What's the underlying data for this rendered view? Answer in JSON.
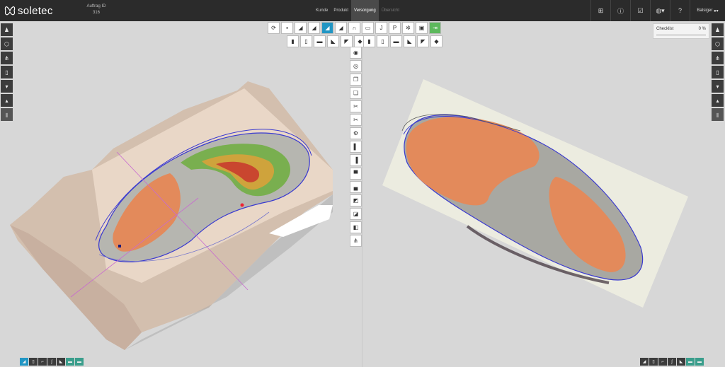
{
  "app": {
    "brand": "soletec"
  },
  "order": {
    "label": "Auftrag ID",
    "id": "316"
  },
  "nav": {
    "items": [
      {
        "label": "Kunde",
        "state": "normal"
      },
      {
        "label": "Produkt",
        "state": "normal"
      },
      {
        "label": "Versorgung",
        "state": "active"
      },
      {
        "label": "Übersicht",
        "state": "disabled"
      }
    ]
  },
  "header_tools": {
    "icons": [
      "apps-grid-icon",
      "info-icon",
      "checkbox-icon",
      "globe-icon",
      "help-icon"
    ],
    "user": "Batsiger"
  },
  "checklist": {
    "label": "Checklist",
    "percent": "0 %",
    "progress": 0
  },
  "toolbar_main": [
    {
      "name": "rotate-icon",
      "glyph": "⟳"
    },
    {
      "name": "layers-icon",
      "glyph": "▪"
    },
    {
      "name": "insole-green-icon",
      "glyph": "◢"
    },
    {
      "name": "insole-dark-icon",
      "glyph": "◢"
    },
    {
      "name": "insole-selected-icon",
      "glyph": "◢",
      "selected": true
    },
    {
      "name": "insole-outline-icon",
      "glyph": "◢"
    },
    {
      "name": "foot-print-icon",
      "glyph": "∩"
    },
    {
      "name": "ruler-icon",
      "glyph": "▭"
    },
    {
      "name": "jpg-download-icon",
      "glyph": "J"
    },
    {
      "name": "pdf-download-icon",
      "glyph": "P"
    },
    {
      "name": "settings-icon",
      "glyph": "✲"
    },
    {
      "name": "save-icon",
      "glyph": "▣"
    },
    {
      "name": "exit-icon",
      "glyph": "⇥",
      "go": true
    }
  ],
  "toolbar_view_left": [
    {
      "name": "view-front-icon",
      "glyph": "▮"
    },
    {
      "name": "view-side-icon",
      "glyph": "▯"
    },
    {
      "name": "view-flat-icon",
      "glyph": "▬"
    },
    {
      "name": "view-heel-icon",
      "glyph": "◣"
    },
    {
      "name": "view-toe-icon",
      "glyph": "◤"
    },
    {
      "name": "view-diag-icon",
      "glyph": "◆"
    }
  ],
  "toolbar_view_right": [
    {
      "name": "view-front-icon",
      "glyph": "▮"
    },
    {
      "name": "view-side-icon",
      "glyph": "▯"
    },
    {
      "name": "view-flat-icon",
      "glyph": "▬"
    },
    {
      "name": "view-heel-icon",
      "glyph": "◣"
    },
    {
      "name": "view-toe-icon",
      "glyph": "◤"
    },
    {
      "name": "view-diag-icon",
      "glyph": "◆"
    }
  ],
  "toolbar_vertical": [
    {
      "name": "eye-icon",
      "glyph": "◉"
    },
    {
      "name": "eye-alt-icon",
      "glyph": "◎"
    },
    {
      "name": "copy-icon",
      "glyph": "❐"
    },
    {
      "name": "duplicate-icon",
      "glyph": "❏"
    },
    {
      "name": "cut-tool-icon",
      "glyph": "✂"
    },
    {
      "name": "scissors-icon",
      "glyph": "✂"
    },
    {
      "name": "gear-icon",
      "glyph": "⚙"
    },
    {
      "name": "panel-left-icon",
      "glyph": "▌"
    },
    {
      "name": "panel-right-icon",
      "glyph": "▐"
    },
    {
      "name": "panel-top-icon",
      "glyph": "▀"
    },
    {
      "name": "panel-bottom-icon",
      "glyph": "▄"
    },
    {
      "name": "panel-cut-icon",
      "glyph": "◩"
    },
    {
      "name": "panel-base-icon",
      "glyph": "◪"
    },
    {
      "name": "shapes-icon",
      "glyph": "◧"
    },
    {
      "name": "feet-icon",
      "glyph": "⋔"
    }
  ],
  "sidebar_left": [
    {
      "name": "foot-icon",
      "glyph": "♟"
    },
    {
      "name": "hexagon-icon",
      "glyph": "⬡"
    },
    {
      "name": "feet-pair-icon",
      "glyph": "⋔"
    },
    {
      "name": "foot-outline-icon",
      "glyph": "▯"
    },
    {
      "name": "heel-icon",
      "glyph": "▾"
    },
    {
      "name": "forefoot-icon",
      "glyph": "▴"
    },
    {
      "name": "foot-disabled-icon",
      "glyph": "▮",
      "disabled": true
    }
  ],
  "sidebar_right": [
    {
      "name": "foot-icon",
      "glyph": "♟"
    },
    {
      "name": "hexagon-icon",
      "glyph": "⬡"
    },
    {
      "name": "feet-pair-icon",
      "glyph": "⋔"
    },
    {
      "name": "foot-outline-icon",
      "glyph": "▯"
    },
    {
      "name": "heel-icon",
      "glyph": "▾"
    },
    {
      "name": "forefoot-icon",
      "glyph": "▴"
    },
    {
      "name": "foot-disabled-icon",
      "glyph": "▮",
      "disabled": true
    }
  ],
  "bottom_left": [
    {
      "name": "insole-mode-icon",
      "glyph": "◢",
      "state": "sel"
    },
    {
      "name": "foot-mode-icon",
      "glyph": "▯"
    },
    {
      "name": "foot-side-icon",
      "glyph": "⌐"
    },
    {
      "name": "leg-icon",
      "glyph": "ʃ"
    },
    {
      "name": "shoe-icon",
      "glyph": "◣"
    },
    {
      "name": "layer-a-icon",
      "glyph": "▬",
      "state": "green"
    },
    {
      "name": "layer-b-icon",
      "glyph": "▬",
      "state": "green"
    }
  ],
  "bottom_right": [
    {
      "name": "insole-mode-icon",
      "glyph": "◢"
    },
    {
      "name": "foot-mode-icon",
      "glyph": "▯"
    },
    {
      "name": "foot-side-icon",
      "glyph": "⌐"
    },
    {
      "name": "leg-icon",
      "glyph": "ʃ"
    },
    {
      "name": "shoe-icon",
      "glyph": "◣"
    },
    {
      "name": "layer-a-icon",
      "glyph": "▬",
      "state": "green"
    },
    {
      "name": "layer-b-icon",
      "glyph": "▬",
      "state": "green"
    }
  ],
  "colors": {
    "accent": "#2196c4",
    "topbar": "#2b2b2b",
    "pad": "#e38a5b",
    "outline": "#3a3ad0",
    "go": "#5cb85c"
  }
}
